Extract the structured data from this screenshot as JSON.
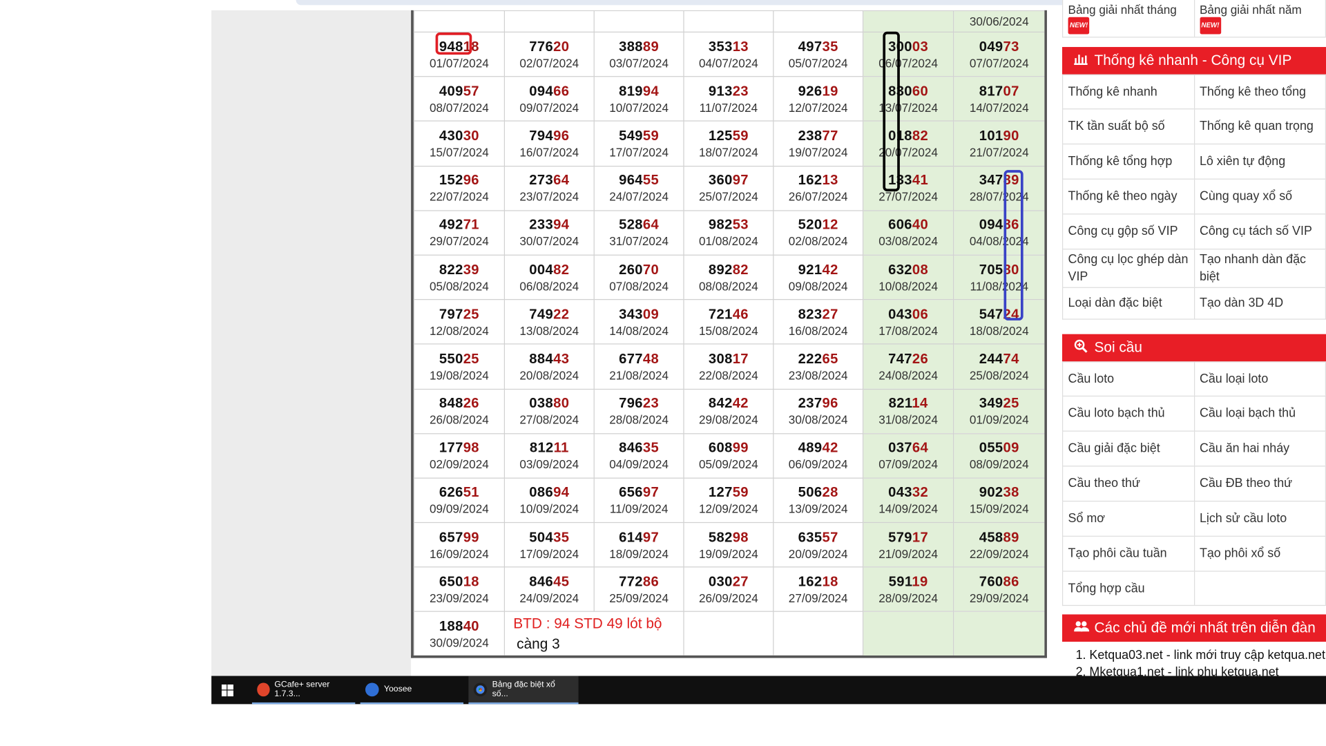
{
  "calendar": {
    "top_row": [
      "",
      "",
      "",
      "",
      "",
      "",
      "30/06/2024"
    ],
    "rows": [
      [
        {
          "head": "948",
          "tail": "18",
          "date": "01/07/2024"
        },
        {
          "head": "776",
          "tail": "20",
          "date": "02/07/2024"
        },
        {
          "head": "388",
          "tail": "89",
          "date": "03/07/2024"
        },
        {
          "head": "353",
          "tail": "13",
          "date": "04/07/2024"
        },
        {
          "head": "497",
          "tail": "35",
          "date": "05/07/2024"
        },
        {
          "head": "300",
          "tail": "03",
          "date": "06/07/2024"
        },
        {
          "head": "049",
          "tail": "73",
          "date": "07/07/2024"
        }
      ],
      [
        {
          "head": "409",
          "tail": "57",
          "date": "08/07/2024"
        },
        {
          "head": "094",
          "tail": "66",
          "date": "09/07/2024"
        },
        {
          "head": "819",
          "tail": "94",
          "date": "10/07/2024"
        },
        {
          "head": "913",
          "tail": "23",
          "date": "11/07/2024"
        },
        {
          "head": "926",
          "tail": "19",
          "date": "12/07/2024"
        },
        {
          "head": "830",
          "tail": "60",
          "date": "13/07/2024"
        },
        {
          "head": "817",
          "tail": "07",
          "date": "14/07/2024"
        }
      ],
      [
        {
          "head": "430",
          "tail": "30",
          "date": "15/07/2024"
        },
        {
          "head": "794",
          "tail": "96",
          "date": "16/07/2024"
        },
        {
          "head": "549",
          "tail": "59",
          "date": "17/07/2024"
        },
        {
          "head": "125",
          "tail": "59",
          "date": "18/07/2024"
        },
        {
          "head": "238",
          "tail": "77",
          "date": "19/07/2024"
        },
        {
          "head": "018",
          "tail": "82",
          "date": "20/07/2024"
        },
        {
          "head": "101",
          "tail": "90",
          "date": "21/07/2024"
        }
      ],
      [
        {
          "head": "152",
          "tail": "96",
          "date": "22/07/2024"
        },
        {
          "head": "273",
          "tail": "64",
          "date": "23/07/2024"
        },
        {
          "head": "964",
          "tail": "55",
          "date": "24/07/2024"
        },
        {
          "head": "360",
          "tail": "97",
          "date": "25/07/2024"
        },
        {
          "head": "162",
          "tail": "13",
          "date": "26/07/2024"
        },
        {
          "head": "133",
          "tail": "41",
          "date": "27/07/2024"
        },
        {
          "head": "347",
          "tail": "89",
          "date": "28/07/2024"
        }
      ],
      [
        {
          "head": "492",
          "tail": "71",
          "date": "29/07/2024"
        },
        {
          "head": "233",
          "tail": "94",
          "date": "30/07/2024"
        },
        {
          "head": "528",
          "tail": "64",
          "date": "31/07/2024"
        },
        {
          "head": "982",
          "tail": "53",
          "date": "01/08/2024"
        },
        {
          "head": "520",
          "tail": "12",
          "date": "02/08/2024"
        },
        {
          "head": "606",
          "tail": "40",
          "date": "03/08/2024"
        },
        {
          "head": "094",
          "tail": "86",
          "date": "04/08/2024"
        }
      ],
      [
        {
          "head": "822",
          "tail": "39",
          "date": "05/08/2024"
        },
        {
          "head": "004",
          "tail": "82",
          "date": "06/08/2024"
        },
        {
          "head": "260",
          "tail": "70",
          "date": "07/08/2024"
        },
        {
          "head": "892",
          "tail": "82",
          "date": "08/08/2024"
        },
        {
          "head": "921",
          "tail": "42",
          "date": "09/08/2024"
        },
        {
          "head": "632",
          "tail": "08",
          "date": "10/08/2024"
        },
        {
          "head": "705",
          "tail": "80",
          "date": "11/08/2024"
        }
      ],
      [
        {
          "head": "797",
          "tail": "25",
          "date": "12/08/2024"
        },
        {
          "head": "749",
          "tail": "22",
          "date": "13/08/2024"
        },
        {
          "head": "343",
          "tail": "09",
          "date": "14/08/2024"
        },
        {
          "head": "721",
          "tail": "46",
          "date": "15/08/2024"
        },
        {
          "head": "823",
          "tail": "27",
          "date": "16/08/2024"
        },
        {
          "head": "043",
          "tail": "06",
          "date": "17/08/2024"
        },
        {
          "head": "547",
          "tail": "24",
          "date": "18/08/2024"
        }
      ],
      [
        {
          "head": "550",
          "tail": "25",
          "date": "19/08/2024"
        },
        {
          "head": "884",
          "tail": "43",
          "date": "20/08/2024"
        },
        {
          "head": "677",
          "tail": "48",
          "date": "21/08/2024"
        },
        {
          "head": "308",
          "tail": "17",
          "date": "22/08/2024"
        },
        {
          "head": "222",
          "tail": "65",
          "date": "23/08/2024"
        },
        {
          "head": "747",
          "tail": "26",
          "date": "24/08/2024"
        },
        {
          "head": "244",
          "tail": "74",
          "date": "25/08/2024"
        }
      ],
      [
        {
          "head": "848",
          "tail": "26",
          "date": "26/08/2024"
        },
        {
          "head": "038",
          "tail": "80",
          "date": "27/08/2024"
        },
        {
          "head": "796",
          "tail": "23",
          "date": "28/08/2024"
        },
        {
          "head": "842",
          "tail": "42",
          "date": "29/08/2024"
        },
        {
          "head": "237",
          "tail": "96",
          "date": "30/08/2024"
        },
        {
          "head": "821",
          "tail": "14",
          "date": "31/08/2024"
        },
        {
          "head": "349",
          "tail": "25",
          "date": "01/09/2024"
        }
      ],
      [
        {
          "head": "177",
          "tail": "98",
          "date": "02/09/2024"
        },
        {
          "head": "812",
          "tail": "11",
          "date": "03/09/2024"
        },
        {
          "head": "846",
          "tail": "35",
          "date": "04/09/2024"
        },
        {
          "head": "608",
          "tail": "99",
          "date": "05/09/2024"
        },
        {
          "head": "489",
          "tail": "42",
          "date": "06/09/2024"
        },
        {
          "head": "037",
          "tail": "64",
          "date": "07/09/2024"
        },
        {
          "head": "055",
          "tail": "09",
          "date": "08/09/2024"
        }
      ],
      [
        {
          "head": "626",
          "tail": "51",
          "date": "09/09/2024"
        },
        {
          "head": "086",
          "tail": "94",
          "date": "10/09/2024"
        },
        {
          "head": "656",
          "tail": "97",
          "date": "11/09/2024"
        },
        {
          "head": "127",
          "tail": "59",
          "date": "12/09/2024"
        },
        {
          "head": "506",
          "tail": "28",
          "date": "13/09/2024"
        },
        {
          "head": "043",
          "tail": "32",
          "date": "14/09/2024"
        },
        {
          "head": "902",
          "tail": "38",
          "date": "15/09/2024"
        }
      ],
      [
        {
          "head": "657",
          "tail": "99",
          "date": "16/09/2024"
        },
        {
          "head": "504",
          "tail": "35",
          "date": "17/09/2024"
        },
        {
          "head": "614",
          "tail": "97",
          "date": "18/09/2024"
        },
        {
          "head": "582",
          "tail": "98",
          "date": "19/09/2024"
        },
        {
          "head": "635",
          "tail": "57",
          "date": "20/09/2024"
        },
        {
          "head": "579",
          "tail": "17",
          "date": "21/09/2024"
        },
        {
          "head": "458",
          "tail": "89",
          "date": "22/09/2024"
        }
      ],
      [
        {
          "head": "650",
          "tail": "18",
          "date": "23/09/2024"
        },
        {
          "head": "846",
          "tail": "45",
          "date": "24/09/2024"
        },
        {
          "head": "772",
          "tail": "86",
          "date": "25/09/2024"
        },
        {
          "head": "030",
          "tail": "27",
          "date": "26/09/2024"
        },
        {
          "head": "162",
          "tail": "18",
          "date": "27/09/2024"
        },
        {
          "head": "591",
          "tail": "19",
          "date": "28/09/2024"
        },
        {
          "head": "760",
          "tail": "86",
          "date": "29/09/2024"
        }
      ]
    ],
    "last_cell": {
      "head": "188",
      "tail": "40",
      "date": "30/09/2024"
    },
    "note_line1": "BTD : 94 STD 49 lót bộ",
    "note_line2": "càng 3"
  },
  "sidebar": {
    "top_left": "Bảng giải nhất tháng",
    "top_right": "Bảng giải nhất năm",
    "new_badge": "NEW!",
    "stats_title": "Thống kê nhanh - Công cụ VIP",
    "stats_items": [
      [
        "Thống kê nhanh",
        "Thống kê theo tổng"
      ],
      [
        "TK tần suất bộ số",
        "Thống kê quan trọng"
      ],
      [
        "Thống kê tổng hợp",
        "Lô xiên tự động"
      ],
      [
        "Thống kê theo ngày",
        "Cùng quay xổ số"
      ],
      [
        "Công cụ gộp số VIP",
        "Công cụ tách số VIP"
      ],
      [
        "Công cụ lọc ghép dàn VIP",
        "Tạo nhanh dàn đặc biệt"
      ],
      [
        "Loại dàn đặc biệt",
        "Tạo dàn 3D 4D"
      ]
    ],
    "soicau_title": "Soi cầu",
    "soicau_items": [
      [
        "Cầu loto",
        "Cầu loại loto"
      ],
      [
        "Cầu loto bạch thủ",
        "Cầu loại bạch thủ"
      ],
      [
        "Cầu giải đặc biệt",
        "Cầu ăn hai nháy"
      ],
      [
        "Cầu theo thứ",
        "Cầu ĐB theo thứ"
      ],
      [
        "Sổ mơ",
        "Lịch sử cầu loto"
      ],
      [
        "Tạo phôi cầu tuần",
        "Tạo phôi xổ số"
      ],
      [
        "Tổng hợp cầu",
        ""
      ]
    ],
    "forum_title": "Các chủ đề mới nhất trên diễn đàn",
    "forum_items": [
      "1. Ketqua03.net - link mới truy cập ketqua.net",
      "2. Mketqua1.net - link phụ ketqua.net"
    ]
  },
  "taskbar": {
    "items": [
      {
        "label": "GCafe+ server 1.7.3...",
        "color": "#e0452b"
      },
      {
        "label": "Yoosee",
        "color": "#2f6fd6"
      },
      {
        "label": "Bảng đặc biệt xổ số...",
        "color": "#e8b62b"
      }
    ]
  },
  "annotations": {
    "red": "#e01f26",
    "black": "#000000",
    "blue": "#3942c6"
  },
  "colors": {
    "tail_digits": "#a31515",
    "weekend_bg": "#e2f0d9",
    "accent": "#e81e26"
  }
}
